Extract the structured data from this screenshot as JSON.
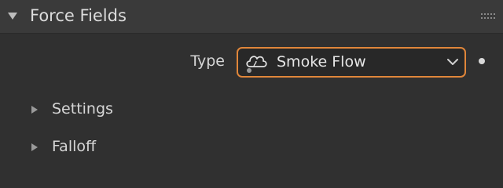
{
  "panel": {
    "title": "Force Fields",
    "expanded": true
  },
  "type_field": {
    "label": "Type",
    "value": "Smoke Flow",
    "value_icon": "smoke-flow-icon",
    "focused": true
  },
  "subpanels": [
    {
      "label": "Settings",
      "expanded": false
    },
    {
      "label": "Falloff",
      "expanded": false
    }
  ],
  "colors": {
    "accent_focus_outline": "#e0863a",
    "background": "#303030",
    "header_background": "#3a3a3a",
    "field_background": "#282828",
    "text": "#d9d9d9"
  }
}
